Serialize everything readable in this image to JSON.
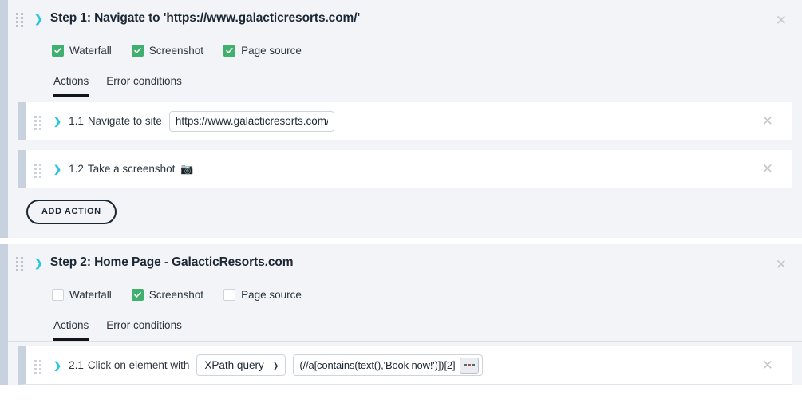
{
  "icons": {
    "chevron_right": "❯",
    "chevron_down": "❯",
    "close": "✕",
    "camera": "📷",
    "select_arrow": "❯"
  },
  "colors": {
    "accent_chevron": "#2bc6e0",
    "checkbox_checked": "#41b06e",
    "panel_bg": "#f2f4f7",
    "panel_left_bar": "#c7d2de",
    "tab_underline": "#111418",
    "row_bg": "#ffffff"
  },
  "steps": [
    {
      "id": "step-1",
      "title": "Step 1: Navigate to 'https://www.galacticresorts.com/'",
      "checkboxes": [
        {
          "label": "Waterfall",
          "checked": true
        },
        {
          "label": "Screenshot",
          "checked": true
        },
        {
          "label": "Page source",
          "checked": true
        }
      ],
      "tabs": [
        {
          "label": "Actions",
          "active": true
        },
        {
          "label": "Error conditions",
          "active": false
        }
      ],
      "actions": [
        {
          "number": "1.1",
          "text": "Navigate to site",
          "input_value": "https://www.galacticresorts.com/",
          "input_placeholder": "https://"
        },
        {
          "number": "1.2",
          "text": "Take a screenshot",
          "emoji": "📷"
        }
      ],
      "add_action_label": "ADD ACTION"
    },
    {
      "id": "step-2",
      "title": "Step 2: Home Page - GalacticResorts.com",
      "checkboxes": [
        {
          "label": "Waterfall",
          "checked": false
        },
        {
          "label": "Screenshot",
          "checked": true
        },
        {
          "label": "Page source",
          "checked": false
        }
      ],
      "tabs": [
        {
          "label": "Actions",
          "active": true
        },
        {
          "label": "Error conditions",
          "active": false
        }
      ],
      "actions": [
        {
          "number": "2.1",
          "text": "Click on element with",
          "selector_type": "XPath query",
          "selector_options": [
            "XPath query"
          ],
          "xpath_value": "(//a[contains(text(),'Book now!')])[2]",
          "ellipsis_label": "..."
        }
      ]
    }
  ]
}
